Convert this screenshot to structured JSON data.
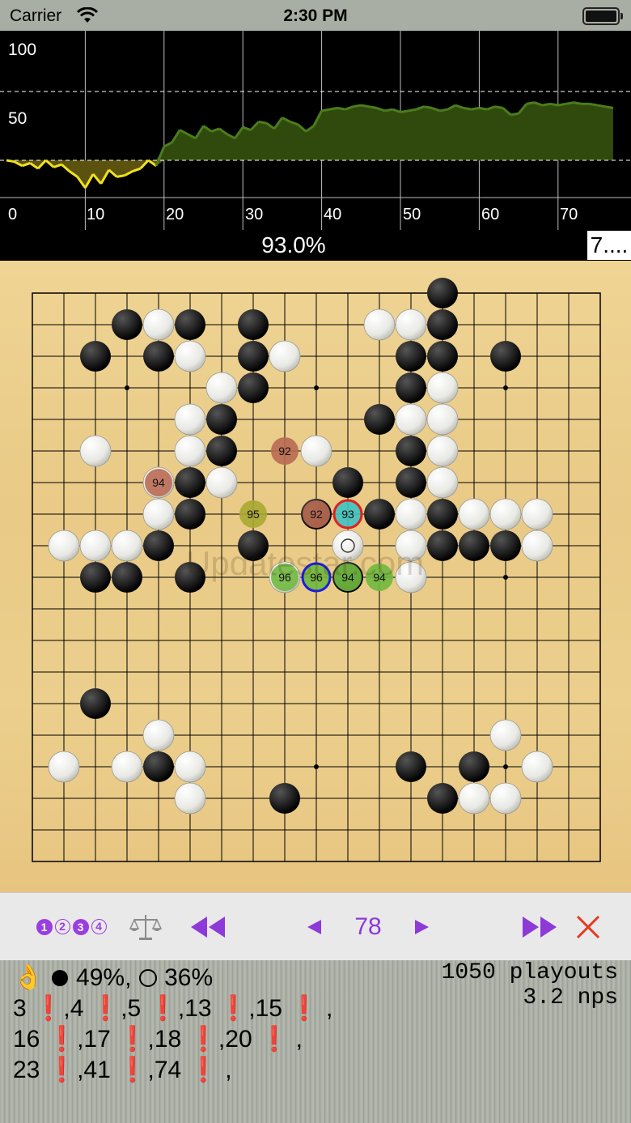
{
  "status_bar": {
    "carrier": "Carrier",
    "time": "2:30 PM"
  },
  "graph": {
    "y_labels": [
      "100",
      "50"
    ],
    "x_labels": [
      "0",
      "10",
      "20",
      "30",
      "40",
      "50",
      "60",
      "70"
    ],
    "series": [
      50,
      49,
      46,
      48,
      44,
      50,
      45,
      47,
      42,
      38,
      30,
      40,
      33,
      43,
      38,
      39,
      42,
      44,
      50,
      46,
      60,
      63,
      72,
      69,
      66,
      75,
      71,
      73,
      69,
      66,
      74,
      72,
      78,
      77,
      73,
      81,
      78,
      76,
      71,
      75,
      86,
      87,
      88,
      87,
      89,
      90,
      89,
      88,
      86,
      87,
      85,
      86,
      87,
      89,
      88,
      86,
      87,
      90,
      88,
      87,
      88,
      87,
      89,
      88,
      83,
      84,
      91,
      92,
      90,
      91,
      90,
      91,
      92,
      91,
      91,
      90,
      89,
      88
    ]
  },
  "win_rate": {
    "percent": "93.0%",
    "badge": "7...."
  },
  "board": {
    "size": 19,
    "hoshi": [
      [
        3,
        3
      ],
      [
        3,
        9
      ],
      [
        3,
        15
      ],
      [
        9,
        3
      ],
      [
        9,
        9
      ],
      [
        9,
        15
      ],
      [
        15,
        3
      ],
      [
        15,
        9
      ],
      [
        15,
        15
      ]
    ],
    "black": [
      [
        13,
        0
      ],
      [
        3,
        1
      ],
      [
        5,
        1
      ],
      [
        7,
        1
      ],
      [
        13,
        1
      ],
      [
        2,
        2
      ],
      [
        4,
        2
      ],
      [
        7,
        2
      ],
      [
        12,
        2
      ],
      [
        13,
        2
      ],
      [
        15,
        2
      ],
      [
        7,
        3
      ],
      [
        12,
        3
      ],
      [
        6,
        4
      ],
      [
        11,
        4
      ],
      [
        6,
        5
      ],
      [
        12,
        5
      ],
      [
        5,
        6
      ],
      [
        10,
        6
      ],
      [
        12,
        6
      ],
      [
        5,
        7
      ],
      [
        9,
        7
      ],
      [
        11,
        7
      ],
      [
        13,
        7
      ],
      [
        4,
        8
      ],
      [
        7,
        8
      ],
      [
        13,
        8
      ],
      [
        14,
        8
      ],
      [
        15,
        8
      ],
      [
        2,
        9
      ],
      [
        3,
        9
      ],
      [
        5,
        9
      ],
      [
        10,
        9
      ],
      [
        2,
        13
      ],
      [
        4,
        15
      ],
      [
        12,
        15
      ],
      [
        14,
        15
      ],
      [
        8,
        16
      ],
      [
        13,
        16
      ]
    ],
    "white": [
      [
        4,
        1
      ],
      [
        11,
        1
      ],
      [
        12,
        1
      ],
      [
        5,
        2
      ],
      [
        8,
        2
      ],
      [
        6,
        3
      ],
      [
        13,
        3
      ],
      [
        5,
        4
      ],
      [
        12,
        4
      ],
      [
        13,
        4
      ],
      [
        2,
        5
      ],
      [
        5,
        5
      ],
      [
        9,
        5
      ],
      [
        13,
        5
      ],
      [
        4,
        6
      ],
      [
        6,
        6
      ],
      [
        13,
        6
      ],
      [
        4,
        7
      ],
      [
        12,
        7
      ],
      [
        14,
        7
      ],
      [
        15,
        7
      ],
      [
        16,
        7
      ],
      [
        1,
        8
      ],
      [
        2,
        8
      ],
      [
        3,
        8
      ],
      [
        12,
        8
      ],
      [
        16,
        8
      ],
      [
        8,
        9
      ],
      [
        12,
        9
      ],
      [
        4,
        14
      ],
      [
        15,
        14
      ],
      [
        1,
        15
      ],
      [
        3,
        15
      ],
      [
        5,
        15
      ],
      [
        16,
        15
      ],
      [
        5,
        16
      ],
      [
        14,
        16
      ],
      [
        15,
        16
      ]
    ],
    "candidates": [
      {
        "x": 8,
        "y": 5,
        "label": "92",
        "color": "#b96a52"
      },
      {
        "x": 4,
        "y": 6,
        "label": "94",
        "color": "#b96a52"
      },
      {
        "x": 7,
        "y": 7,
        "label": "95",
        "color": "#a8a832"
      },
      {
        "x": 9,
        "y": 7,
        "label": "92",
        "color": "#b96a52"
      },
      {
        "x": 10,
        "y": 7,
        "label": "93",
        "color": "#3ec2c2",
        "ring": "#e02020"
      },
      {
        "x": 8,
        "y": 9,
        "label": "96",
        "color": "#6fb83e"
      },
      {
        "x": 9,
        "y": 9,
        "label": "96",
        "color": "#6fb83e",
        "ring": "#1c1ce0"
      },
      {
        "x": 10,
        "y": 9,
        "label": "94",
        "color": "#6fb83e"
      },
      {
        "x": 11,
        "y": 9,
        "label": "94",
        "color": "#6fb83e"
      }
    ],
    "last_move": {
      "x": 10,
      "y": 8
    },
    "watermark": "Updatestar.com"
  },
  "toolbar": {
    "numbers": [
      "1",
      "2",
      "3",
      "4"
    ],
    "scale_icon": "balance-scale-icon",
    "move_number": "78",
    "accent": "#8e3ad8"
  },
  "info": {
    "hand_icon": "ok-hand-icon",
    "black_pct": "49%,",
    "white_pct": "36%",
    "playouts": "1050 playouts",
    "nps": "3.2 nps",
    "mistake_rows": [
      [
        "3",
        "4",
        "5",
        "13",
        "15"
      ],
      [
        "16",
        "17",
        "18",
        "20"
      ],
      [
        "23",
        "41",
        "74"
      ]
    ]
  }
}
